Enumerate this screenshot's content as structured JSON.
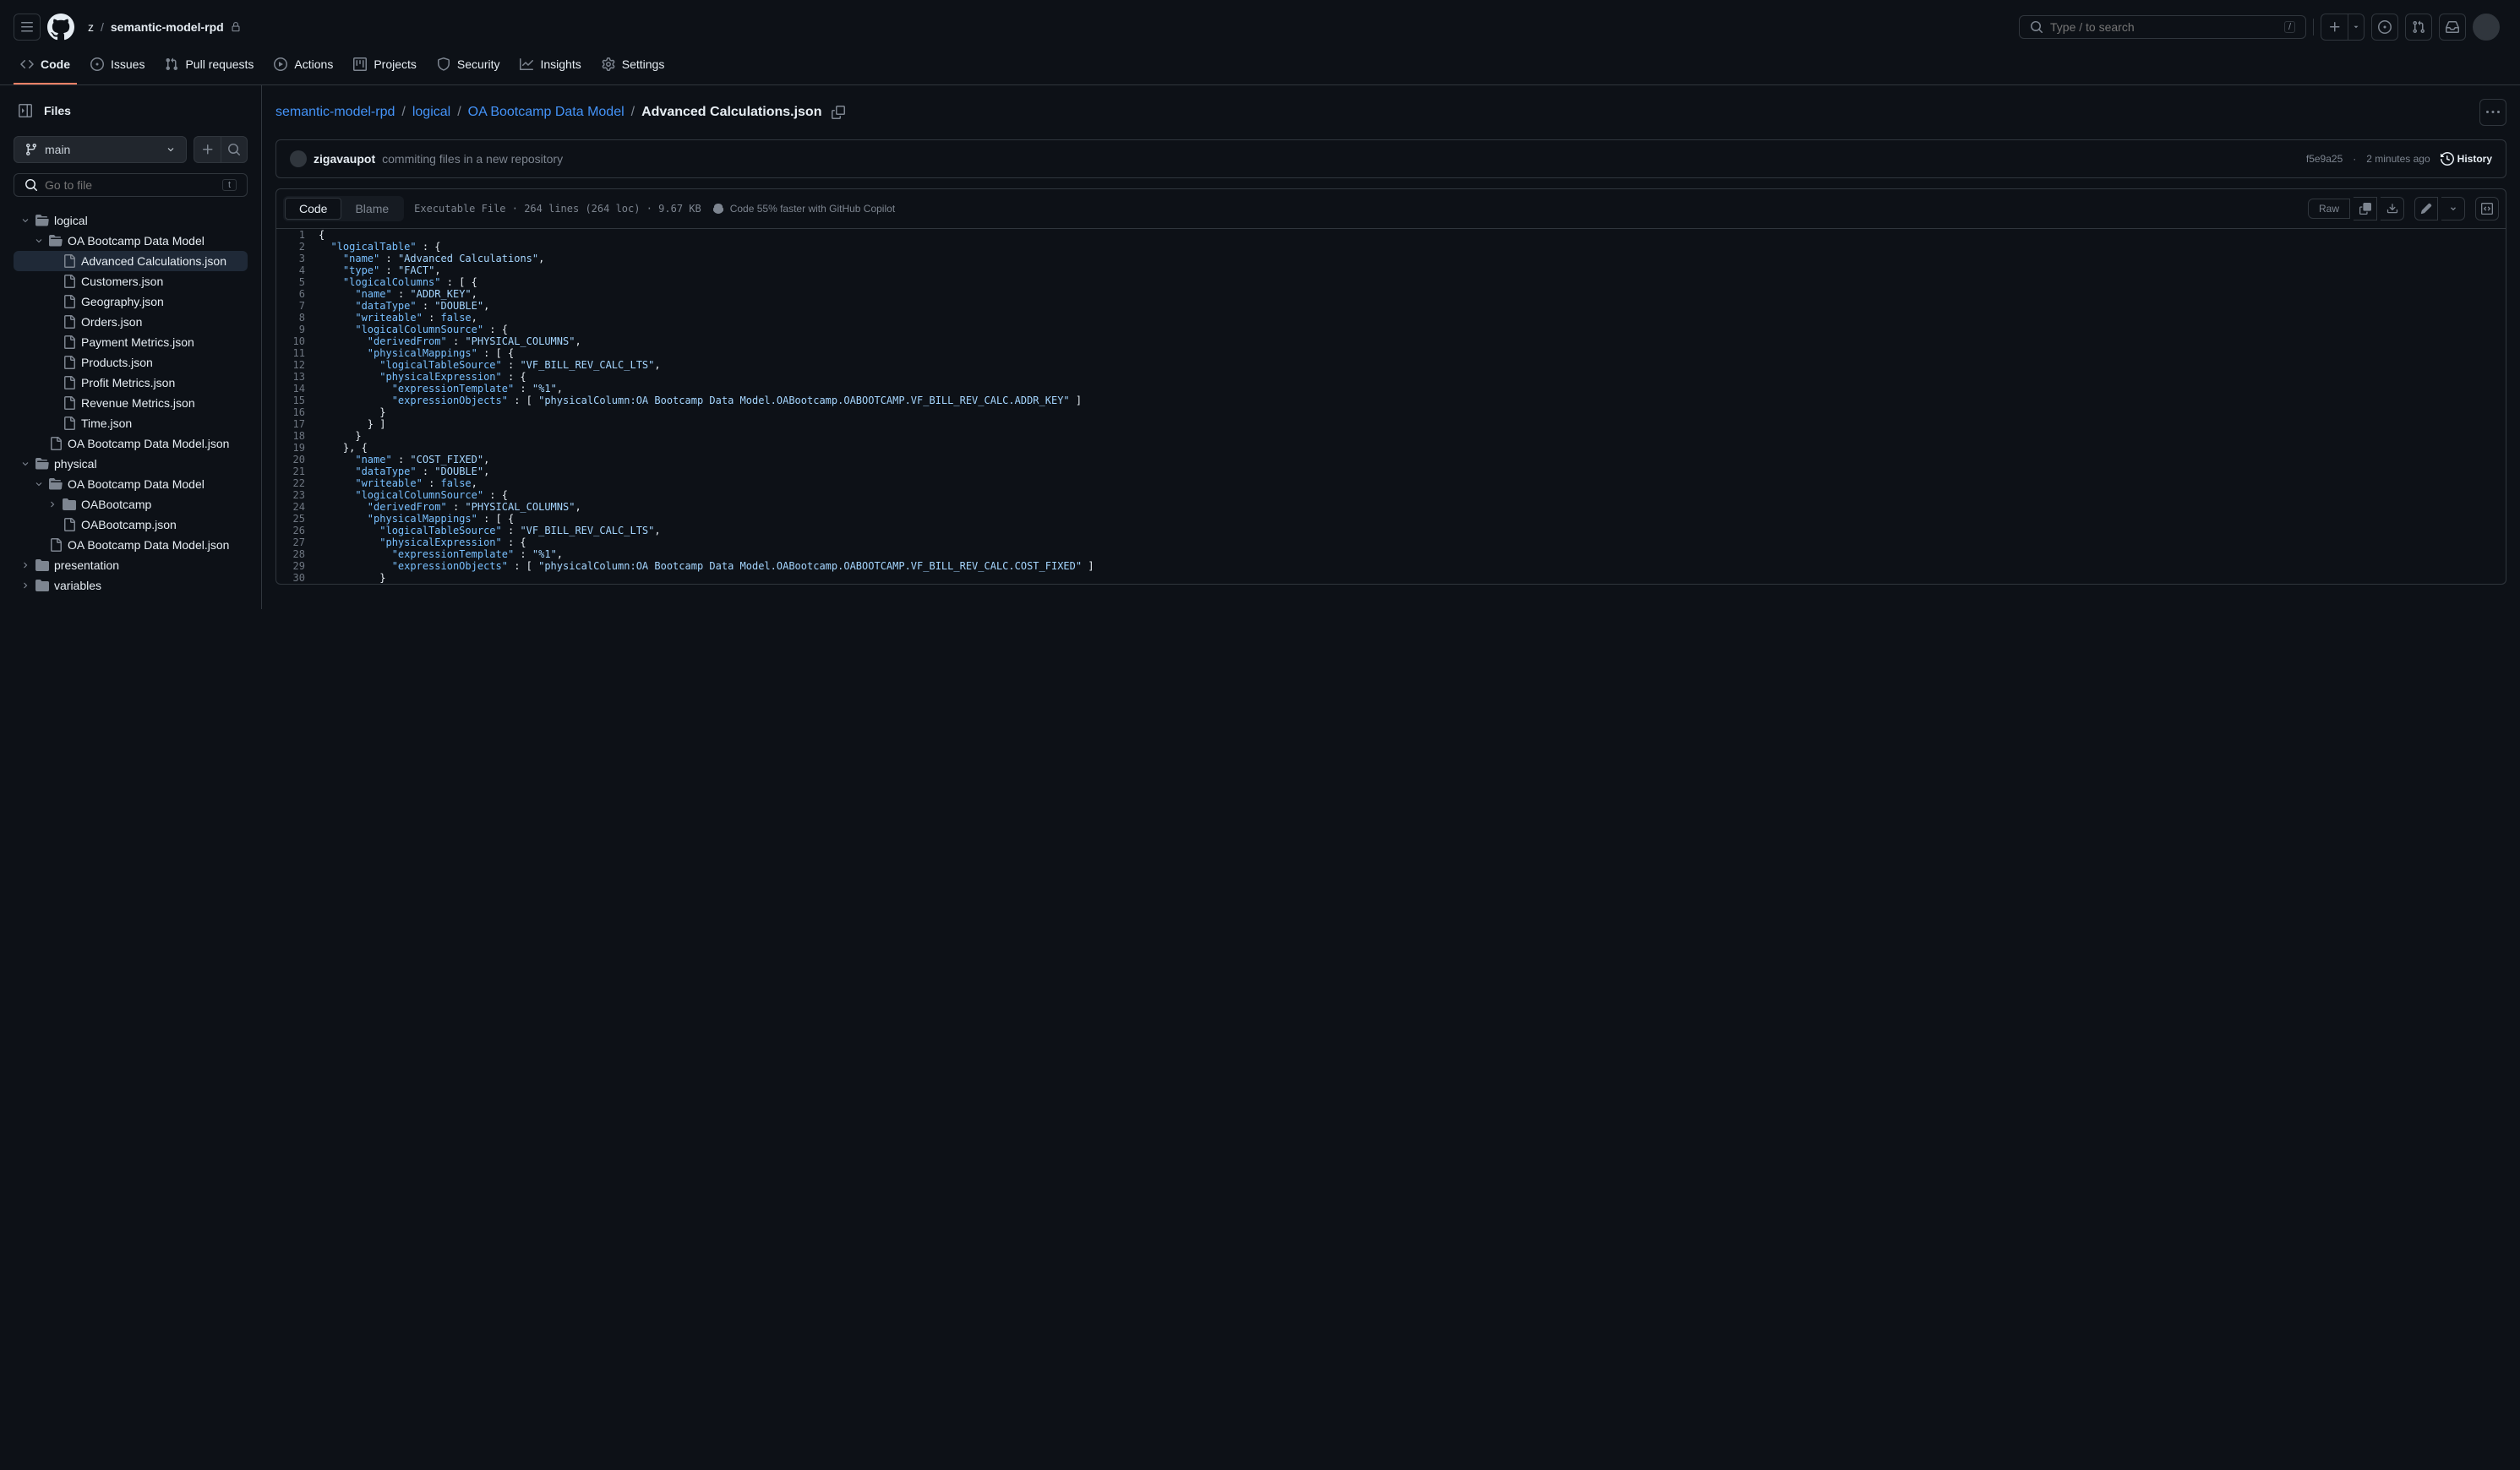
{
  "header": {
    "owner": "z",
    "repo": "semantic-model-rpd",
    "search_placeholder": "Type / to search"
  },
  "nav": {
    "code": "Code",
    "issues": "Issues",
    "pulls": "Pull requests",
    "actions": "Actions",
    "projects": "Projects",
    "security": "Security",
    "insights": "Insights",
    "settings": "Settings"
  },
  "sidebar": {
    "title": "Files",
    "branch": "main",
    "search_placeholder": "Go to file",
    "search_key": "t",
    "tree": {
      "logical": "logical",
      "oa_bootcamp_1": "OA Bootcamp Data Model",
      "files_1": [
        "Advanced Calculations.json",
        "Customers.json",
        "Geography.json",
        "Orders.json",
        "Payment Metrics.json",
        "Products.json",
        "Profit Metrics.json",
        "Revenue Metrics.json",
        "Time.json"
      ],
      "oa_bootcamp_json_1": "OA Bootcamp Data Model.json",
      "physical": "physical",
      "oa_bootcamp_2": "OA Bootcamp Data Model",
      "oabootcamp": "OABootcamp",
      "oabootcamp_json": "OABootcamp.json",
      "oa_bootcamp_json_2": "OA Bootcamp Data Model.json",
      "presentation": "presentation",
      "variables": "variables"
    }
  },
  "breadcrumb": {
    "repo": "semantic-model-rpd",
    "logical": "logical",
    "model": "OA Bootcamp Data Model",
    "file": "Advanced Calculations.json"
  },
  "commit": {
    "author": "zigavaupot",
    "message": "commiting files in a new repository",
    "sha": "f5e9a25",
    "time": "2 minutes ago",
    "history": "History"
  },
  "toolbar": {
    "code": "Code",
    "blame": "Blame",
    "file_info": "Executable File · 264 lines (264 loc) · 9.67 KB",
    "copilot": "Code 55% faster with GitHub Copilot",
    "raw": "Raw"
  },
  "code_lines": [
    {
      "n": 1,
      "indent": 0,
      "tokens": [
        {
          "t": "punc",
          "v": "{"
        }
      ]
    },
    {
      "n": 2,
      "indent": 1,
      "tokens": [
        {
          "t": "key",
          "v": "\"logicalTable\""
        },
        {
          "t": "punc",
          "v": " : {"
        }
      ]
    },
    {
      "n": 3,
      "indent": 2,
      "tokens": [
        {
          "t": "key",
          "v": "\"name\""
        },
        {
          "t": "punc",
          "v": " : "
        },
        {
          "t": "str",
          "v": "\"Advanced Calculations\""
        },
        {
          "t": "punc",
          "v": ","
        }
      ]
    },
    {
      "n": 4,
      "indent": 2,
      "tokens": [
        {
          "t": "key",
          "v": "\"type\""
        },
        {
          "t": "punc",
          "v": " : "
        },
        {
          "t": "str",
          "v": "\"FACT\""
        },
        {
          "t": "punc",
          "v": ","
        }
      ]
    },
    {
      "n": 5,
      "indent": 2,
      "tokens": [
        {
          "t": "key",
          "v": "\"logicalColumns\""
        },
        {
          "t": "punc",
          "v": " : [ {"
        }
      ]
    },
    {
      "n": 6,
      "indent": 3,
      "tokens": [
        {
          "t": "key",
          "v": "\"name\""
        },
        {
          "t": "punc",
          "v": " : "
        },
        {
          "t": "str",
          "v": "\"ADDR_KEY\""
        },
        {
          "t": "punc",
          "v": ","
        }
      ]
    },
    {
      "n": 7,
      "indent": 3,
      "tokens": [
        {
          "t": "key",
          "v": "\"dataType\""
        },
        {
          "t": "punc",
          "v": " : "
        },
        {
          "t": "str",
          "v": "\"DOUBLE\""
        },
        {
          "t": "punc",
          "v": ","
        }
      ]
    },
    {
      "n": 8,
      "indent": 3,
      "tokens": [
        {
          "t": "key",
          "v": "\"writeable\""
        },
        {
          "t": "punc",
          "v": " : "
        },
        {
          "t": "bool",
          "v": "false"
        },
        {
          "t": "punc",
          "v": ","
        }
      ]
    },
    {
      "n": 9,
      "indent": 3,
      "tokens": [
        {
          "t": "key",
          "v": "\"logicalColumnSource\""
        },
        {
          "t": "punc",
          "v": " : {"
        }
      ]
    },
    {
      "n": 10,
      "indent": 4,
      "tokens": [
        {
          "t": "key",
          "v": "\"derivedFrom\""
        },
        {
          "t": "punc",
          "v": " : "
        },
        {
          "t": "str",
          "v": "\"PHYSICAL_COLUMNS\""
        },
        {
          "t": "punc",
          "v": ","
        }
      ]
    },
    {
      "n": 11,
      "indent": 4,
      "tokens": [
        {
          "t": "key",
          "v": "\"physicalMappings\""
        },
        {
          "t": "punc",
          "v": " : [ {"
        }
      ]
    },
    {
      "n": 12,
      "indent": 5,
      "tokens": [
        {
          "t": "key",
          "v": "\"logicalTableSource\""
        },
        {
          "t": "punc",
          "v": " : "
        },
        {
          "t": "str",
          "v": "\"VF_BILL_REV_CALC_LTS\""
        },
        {
          "t": "punc",
          "v": ","
        }
      ]
    },
    {
      "n": 13,
      "indent": 5,
      "tokens": [
        {
          "t": "key",
          "v": "\"physicalExpression\""
        },
        {
          "t": "punc",
          "v": " : {"
        }
      ]
    },
    {
      "n": 14,
      "indent": 6,
      "tokens": [
        {
          "t": "key",
          "v": "\"expressionTemplate\""
        },
        {
          "t": "punc",
          "v": " : "
        },
        {
          "t": "str",
          "v": "\"%1\""
        },
        {
          "t": "punc",
          "v": ","
        }
      ]
    },
    {
      "n": 15,
      "indent": 6,
      "tokens": [
        {
          "t": "key",
          "v": "\"expressionObjects\""
        },
        {
          "t": "punc",
          "v": " : [ "
        },
        {
          "t": "str",
          "v": "\"physicalColumn:OA Bootcamp Data Model.OABootcamp.OABOOTCAMP.VF_BILL_REV_CALC.ADDR_KEY\""
        },
        {
          "t": "punc",
          "v": " ]"
        }
      ]
    },
    {
      "n": 16,
      "indent": 5,
      "tokens": [
        {
          "t": "punc",
          "v": "}"
        }
      ]
    },
    {
      "n": 17,
      "indent": 4,
      "tokens": [
        {
          "t": "punc",
          "v": "} ]"
        }
      ]
    },
    {
      "n": 18,
      "indent": 3,
      "tokens": [
        {
          "t": "punc",
          "v": "}"
        }
      ]
    },
    {
      "n": 19,
      "indent": 2,
      "tokens": [
        {
          "t": "punc",
          "v": "}, {"
        }
      ]
    },
    {
      "n": 20,
      "indent": 3,
      "tokens": [
        {
          "t": "key",
          "v": "\"name\""
        },
        {
          "t": "punc",
          "v": " : "
        },
        {
          "t": "str",
          "v": "\"COST_FIXED\""
        },
        {
          "t": "punc",
          "v": ","
        }
      ]
    },
    {
      "n": 21,
      "indent": 3,
      "tokens": [
        {
          "t": "key",
          "v": "\"dataType\""
        },
        {
          "t": "punc",
          "v": " : "
        },
        {
          "t": "str",
          "v": "\"DOUBLE\""
        },
        {
          "t": "punc",
          "v": ","
        }
      ]
    },
    {
      "n": 22,
      "indent": 3,
      "tokens": [
        {
          "t": "key",
          "v": "\"writeable\""
        },
        {
          "t": "punc",
          "v": " : "
        },
        {
          "t": "bool",
          "v": "false"
        },
        {
          "t": "punc",
          "v": ","
        }
      ]
    },
    {
      "n": 23,
      "indent": 3,
      "tokens": [
        {
          "t": "key",
          "v": "\"logicalColumnSource\""
        },
        {
          "t": "punc",
          "v": " : {"
        }
      ]
    },
    {
      "n": 24,
      "indent": 4,
      "tokens": [
        {
          "t": "key",
          "v": "\"derivedFrom\""
        },
        {
          "t": "punc",
          "v": " : "
        },
        {
          "t": "str",
          "v": "\"PHYSICAL_COLUMNS\""
        },
        {
          "t": "punc",
          "v": ","
        }
      ]
    },
    {
      "n": 25,
      "indent": 4,
      "tokens": [
        {
          "t": "key",
          "v": "\"physicalMappings\""
        },
        {
          "t": "punc",
          "v": " : [ {"
        }
      ]
    },
    {
      "n": 26,
      "indent": 5,
      "tokens": [
        {
          "t": "key",
          "v": "\"logicalTableSource\""
        },
        {
          "t": "punc",
          "v": " : "
        },
        {
          "t": "str",
          "v": "\"VF_BILL_REV_CALC_LTS\""
        },
        {
          "t": "punc",
          "v": ","
        }
      ]
    },
    {
      "n": 27,
      "indent": 5,
      "tokens": [
        {
          "t": "key",
          "v": "\"physicalExpression\""
        },
        {
          "t": "punc",
          "v": " : {"
        }
      ]
    },
    {
      "n": 28,
      "indent": 6,
      "tokens": [
        {
          "t": "key",
          "v": "\"expressionTemplate\""
        },
        {
          "t": "punc",
          "v": " : "
        },
        {
          "t": "str",
          "v": "\"%1\""
        },
        {
          "t": "punc",
          "v": ","
        }
      ]
    },
    {
      "n": 29,
      "indent": 6,
      "tokens": [
        {
          "t": "key",
          "v": "\"expressionObjects\""
        },
        {
          "t": "punc",
          "v": " : [ "
        },
        {
          "t": "str",
          "v": "\"physicalColumn:OA Bootcamp Data Model.OABootcamp.OABOOTCAMP.VF_BILL_REV_CALC.COST_FIXED\""
        },
        {
          "t": "punc",
          "v": " ]"
        }
      ]
    },
    {
      "n": 30,
      "indent": 5,
      "tokens": [
        {
          "t": "punc",
          "v": "}"
        }
      ]
    }
  ]
}
